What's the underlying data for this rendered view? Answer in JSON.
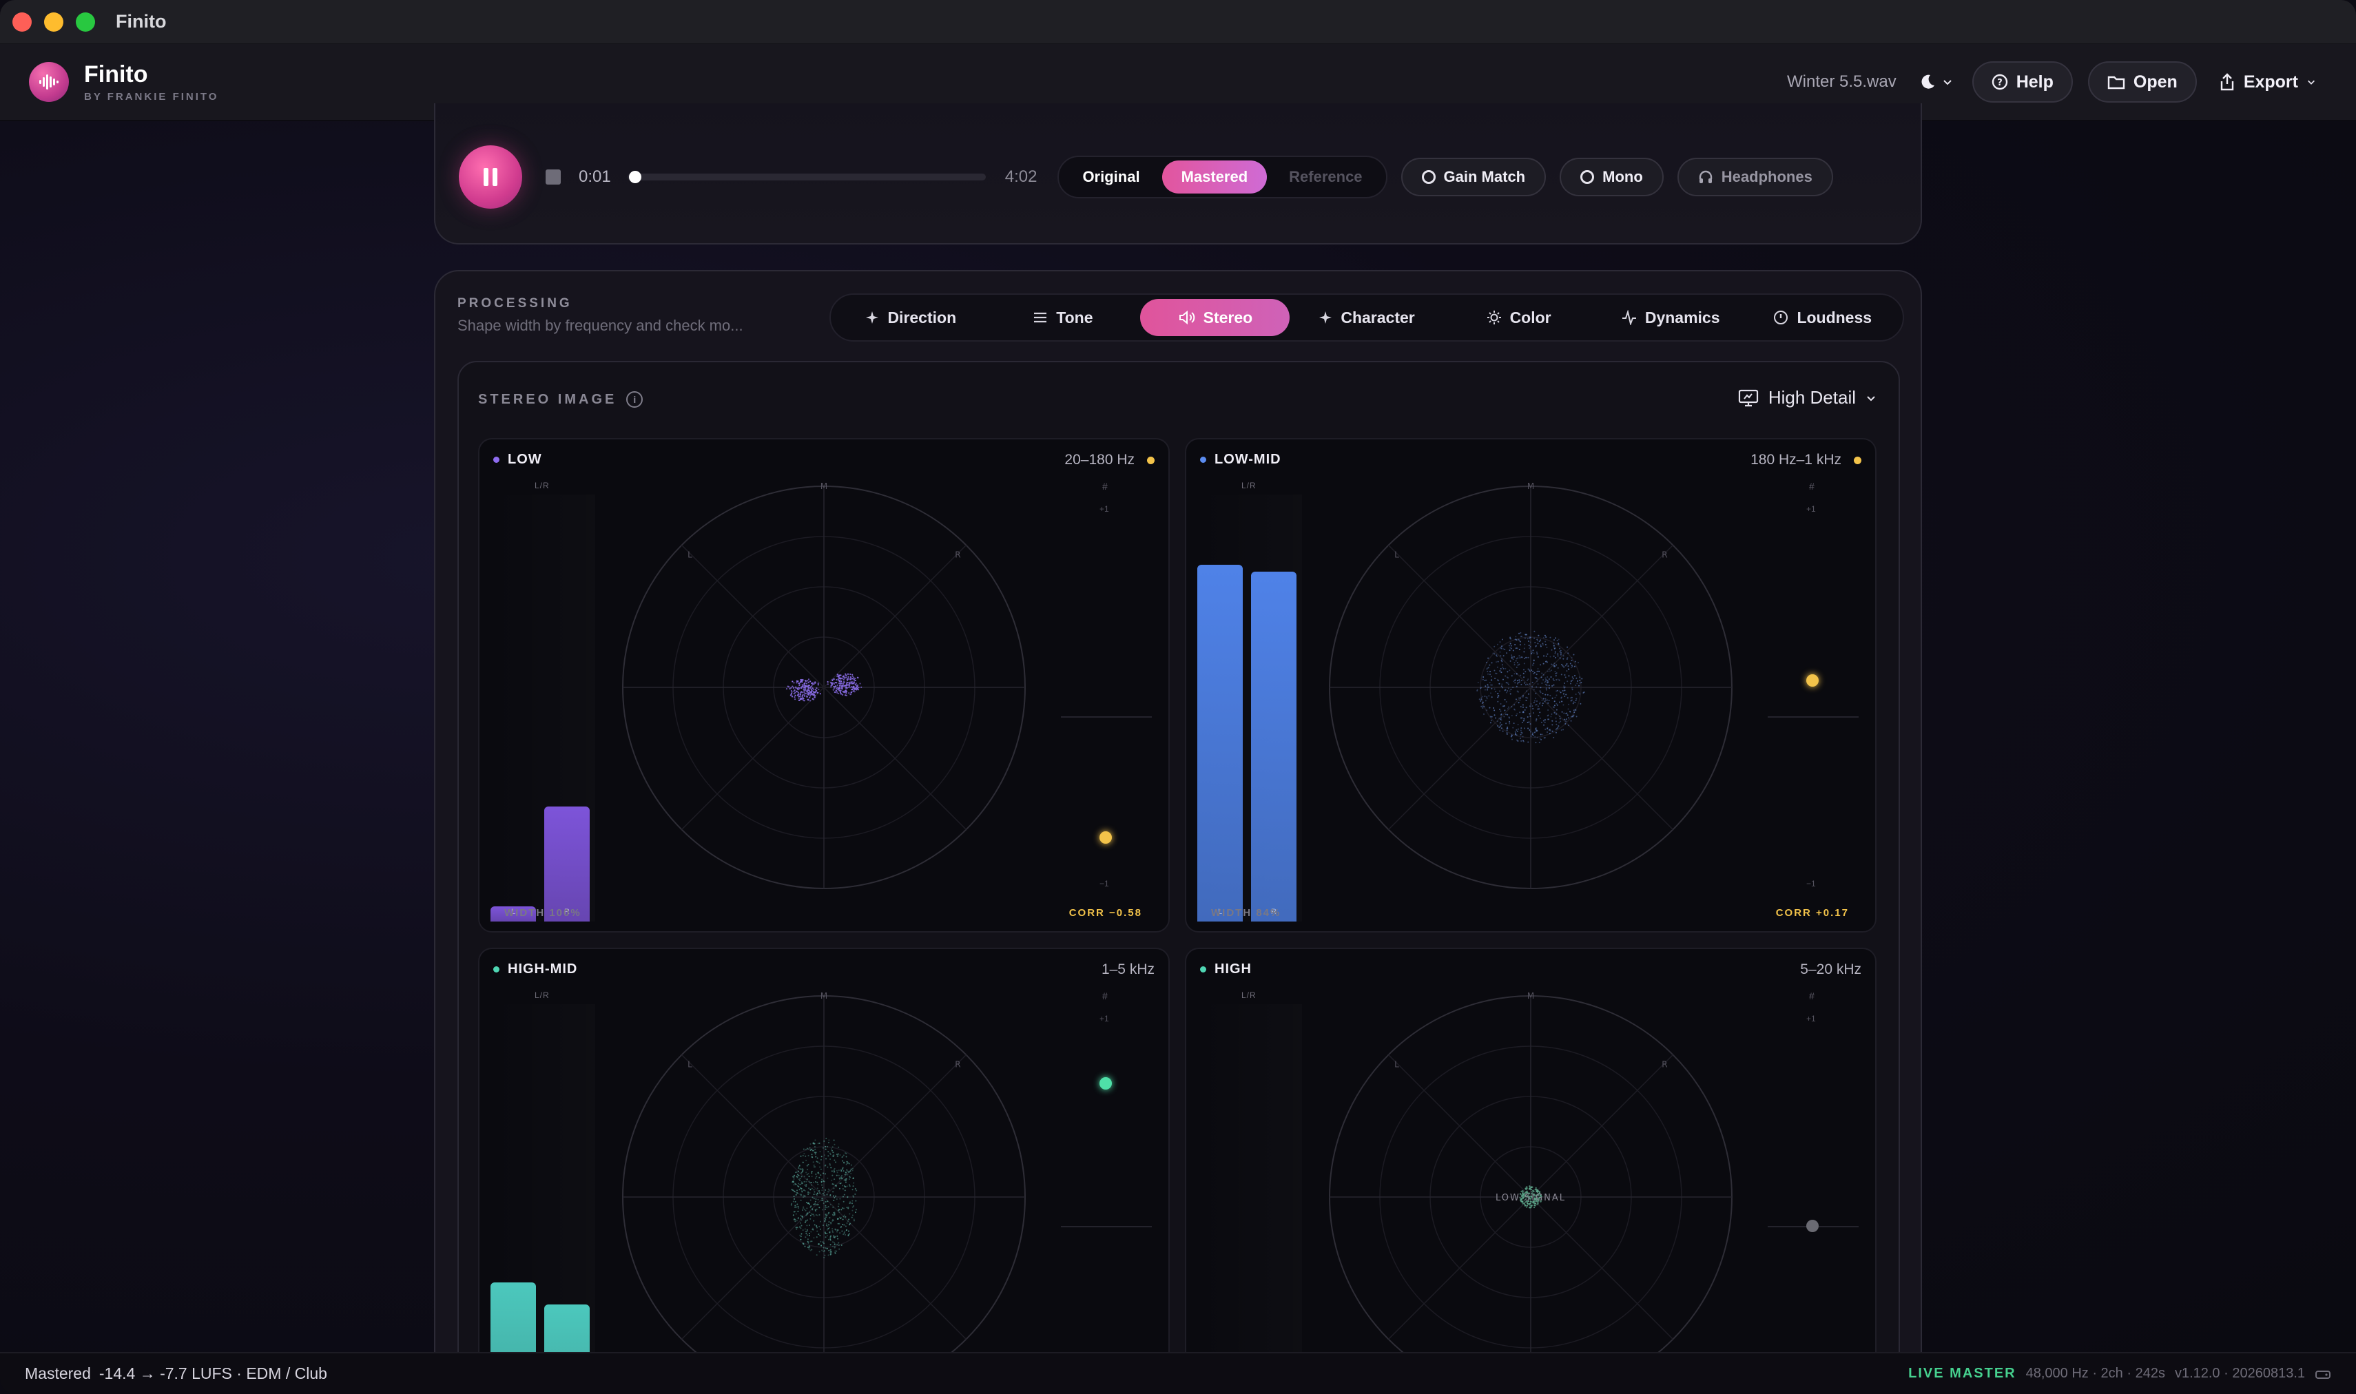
{
  "window": {
    "title": "Finito"
  },
  "header": {
    "app_name": "Finito",
    "app_subtitle": "BY FRANKIE FINITO",
    "filename": "Winter 5.5.wav",
    "help_label": "Help",
    "open_label": "Open",
    "export_label": "Export"
  },
  "transport": {
    "current_time": "0:01",
    "total_time": "4:02",
    "progress": 0.004,
    "sources": [
      {
        "label": "Original",
        "state": "normal"
      },
      {
        "label": "Mastered",
        "state": "active"
      },
      {
        "label": "Reference",
        "state": "disabled"
      }
    ],
    "gain_match_label": "Gain Match",
    "mono_label": "Mono",
    "headphones_label": "Headphones"
  },
  "processing": {
    "label": "PROCESSING",
    "description": "Shape width by frequency and check mo...",
    "tabs": [
      {
        "label": "Direction",
        "icon": "sparkle-icon",
        "active": false
      },
      {
        "label": "Tone",
        "icon": "sliders-icon",
        "active": false
      },
      {
        "label": "Stereo",
        "icon": "speaker-icon",
        "active": true
      },
      {
        "label": "Character",
        "icon": "sparkle-icon",
        "active": false
      },
      {
        "label": "Color",
        "icon": "sun-icon",
        "active": false
      },
      {
        "label": "Dynamics",
        "icon": "pulse-icon",
        "active": false
      },
      {
        "label": "Loudness",
        "icon": "gauge-icon",
        "active": false
      }
    ]
  },
  "stereo": {
    "title": "STEREO IMAGE",
    "detail_mode": "High Detail",
    "axis": {
      "lr": "L/R",
      "m": "M",
      "l": "L",
      "r": "R",
      "hash": "#",
      "plus": "+1",
      "minus": "−1"
    },
    "bands": [
      {
        "name": "LOW",
        "range": "20–180 Hz",
        "accent": "#8e6cf0",
        "meter_l": 0.04,
        "meter_r": 0.31,
        "bar_color": "#7d54d9",
        "width_label": "WIDTH 100%",
        "corr_label": "CORR −0.58",
        "corr": -0.58,
        "corr_color": "#f3c34a",
        "status_dot": "#f3c34a",
        "scatter": "butterfly",
        "scatter_color": "#8b6ee8"
      },
      {
        "name": "LOW-MID",
        "range": "180 Hz–1 kHz",
        "accent": "#5b8cf0",
        "meter_l": 0.96,
        "meter_r": 0.94,
        "bar_color": "#4f82e8",
        "width_label": "WIDTH 84%",
        "corr_label": "CORR +0.17",
        "corr": 0.17,
        "corr_color": "#f3c34a",
        "status_dot": "#f3c34a",
        "scatter": "cloud",
        "scatter_color": "#5f7fbf"
      },
      {
        "name": "HIGH-MID",
        "range": "1–5 kHz",
        "accent": "#4fd6b3",
        "meter_l": 0.4,
        "meter_r": 0.34,
        "bar_color": "#4cc8bd",
        "width_label": "",
        "corr_label": "",
        "corr": 0.68,
        "corr_color": "#4fe0a8",
        "status_dot": "",
        "scatter": "ellipse",
        "scatter_color": "#5aa79a"
      },
      {
        "name": "HIGH",
        "range": "5–20 kHz",
        "accent": "#4fd6b3",
        "meter_l": 0,
        "meter_r": 0,
        "bar_color": "#4cc8bd",
        "width_label": "",
        "corr_label": "",
        "corr": 0.0,
        "corr_color": "#6a6a72",
        "status_dot": "",
        "scatter": "point",
        "scatter_color": "#5fa88c",
        "overlay": "LOW SIGNAL"
      }
    ]
  },
  "status": {
    "mode": "Mastered",
    "loudness": "-14.4 → -7.7 LUFS · EDM / Club",
    "live_label": "LIVE MASTER",
    "info": "48,000 Hz · 2ch · 242s",
    "version": "v1.12.0 · 20260813.1"
  }
}
